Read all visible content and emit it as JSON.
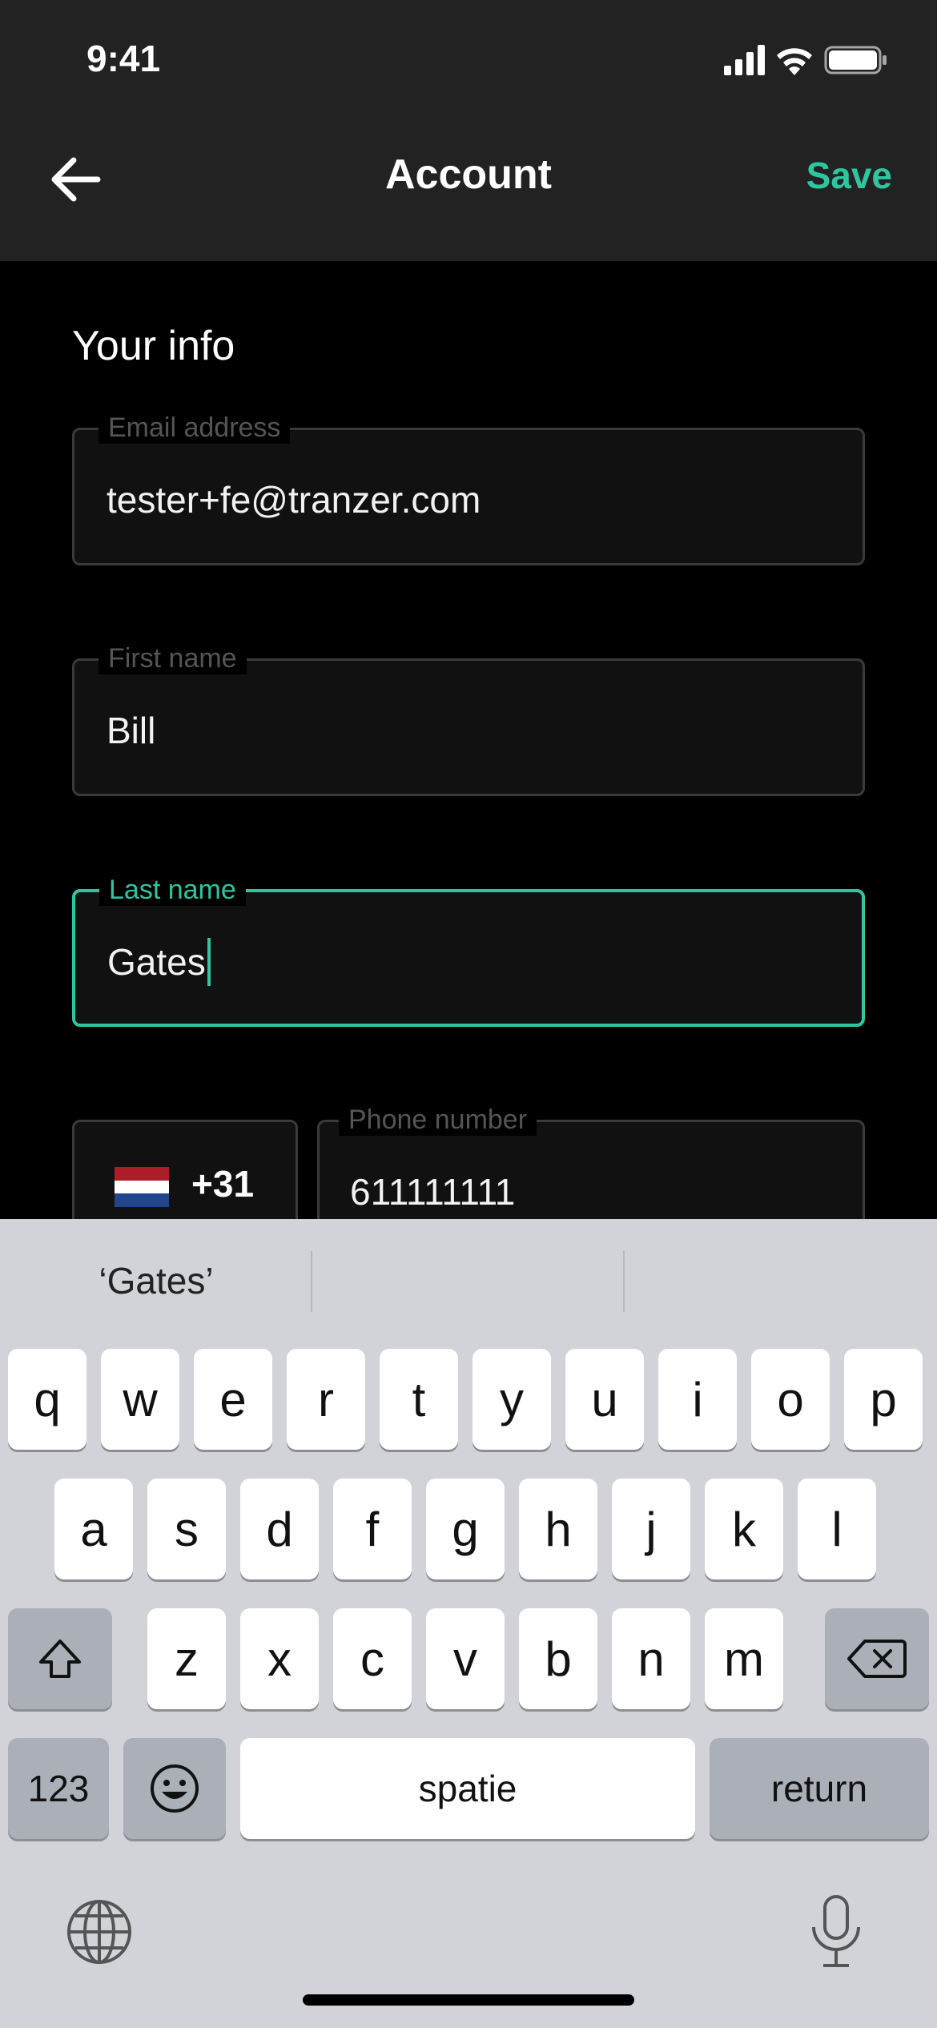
{
  "status_bar": {
    "time": "9:41"
  },
  "nav": {
    "title": "Account",
    "save_label": "Save"
  },
  "section": {
    "title": "Your info"
  },
  "fields": {
    "email": {
      "label": "Email address",
      "value": "tester+fe@tranzer.com"
    },
    "first_name": {
      "label": "First name",
      "value": "Bill"
    },
    "last_name": {
      "label": "Last name",
      "value": "Gates"
    },
    "country_code": "+31",
    "phone": {
      "label": "Phone number",
      "value": "611111111"
    }
  },
  "colors": {
    "accent": "#2fc5a0",
    "background": "#000000",
    "bar": "#222222"
  },
  "keyboard": {
    "suggestions": [
      "‘Gates’",
      "",
      ""
    ],
    "row1": [
      "q",
      "w",
      "e",
      "r",
      "t",
      "y",
      "u",
      "i",
      "o",
      "p"
    ],
    "row2": [
      "a",
      "s",
      "d",
      "f",
      "g",
      "h",
      "j",
      "k",
      "l"
    ],
    "row3": [
      "z",
      "x",
      "c",
      "v",
      "b",
      "n",
      "m"
    ],
    "numbers_label": "123",
    "space_label": "spatie",
    "return_label": "return",
    "icons": [
      "shift-icon",
      "backspace-icon",
      "emoji-icon",
      "globe-icon",
      "microphone-icon"
    ]
  }
}
